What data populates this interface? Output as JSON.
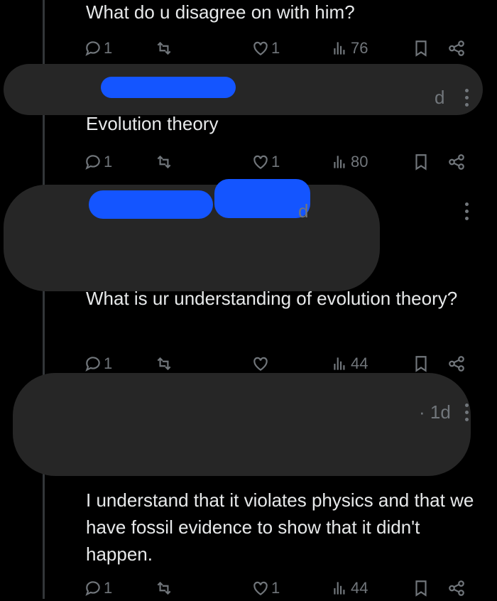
{
  "tweets": [
    {
      "text": "What do u disagree on with him?",
      "replies": "1",
      "retweets": "",
      "likes": "1",
      "views": "76"
    },
    {
      "text": "Evolution theory",
      "replies": "1",
      "retweets": "",
      "likes": "1",
      "views": "80",
      "age": "d"
    },
    {
      "text": "What is ur understanding of evolution theory?",
      "replies": "1",
      "retweets": "",
      "likes": "",
      "views": "44",
      "age": "d"
    },
    {
      "text": "I understand that it violates physics and that we have fossil evidence to show that it didn't happen.",
      "replies": "1",
      "retweets": "",
      "likes": "1",
      "views": "44",
      "age": "· 1d"
    }
  ],
  "icons": [
    "reply-icon",
    "retweet-icon",
    "like-icon",
    "views-icon",
    "bookmark-icon",
    "share-icon",
    "more-icon"
  ],
  "colors": {
    "background": "#000000",
    "text": "#e7e9ea",
    "muted": "#71767b",
    "redaction_blue": "#1455ff",
    "redaction_dark": "#262626"
  }
}
